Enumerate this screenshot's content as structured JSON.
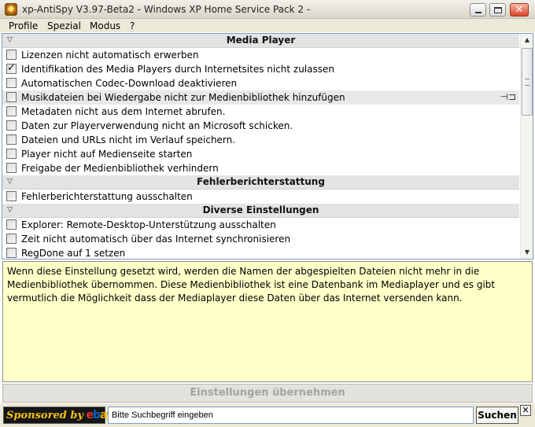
{
  "window": {
    "title": "xp-AntiSpy V3.97-Beta2 - Windows XP Home Service Pack 2 -",
    "minimize_glyph": "",
    "maximize_glyph": "",
    "close_glyph": "✕"
  },
  "menu": {
    "items": [
      "Profile",
      "Spezial",
      "Modus",
      "?"
    ]
  },
  "list": {
    "groups": [
      {
        "title": "Media Player",
        "items": [
          {
            "label": "Lizenzen nicht automatisch erwerben",
            "checked": false
          },
          {
            "label": "Identifikation des Media Players durch Internetsites nicht zulassen",
            "checked": true
          },
          {
            "label": "Automatischen Codec-Download deaktivieren",
            "checked": false
          },
          {
            "label": "Musikdateien bei Wiedergabe nicht zur Medienbibliothek hinzufügen",
            "checked": false,
            "selected": true
          },
          {
            "label": "Metadaten nicht aus dem Internet abrufen.",
            "checked": false
          },
          {
            "label": "Daten zur Playerverwendung nicht an Microsoft schicken.",
            "checked": false
          },
          {
            "label": "Dateien und URLs nicht im Verlauf speichern.",
            "checked": false
          },
          {
            "label": "Player nicht auf Medienseite starten",
            "checked": false
          },
          {
            "label": "Freigabe der Medienbibliothek verhindern",
            "checked": false
          }
        ]
      },
      {
        "title": "Fehlerberichterstattung",
        "items": [
          {
            "label": "Fehlerberichterstattung ausschalten",
            "checked": false
          }
        ]
      },
      {
        "title": "Diverse Einstellungen",
        "items": [
          {
            "label": "Explorer: Remote-Desktop-Unterstützung ausschalten",
            "checked": false
          },
          {
            "label": "Zeit nicht automatisch über das Internet synchronisieren",
            "checked": false
          },
          {
            "label": "RegDone auf 1 setzen",
            "checked": false
          }
        ]
      }
    ],
    "collapse_icon": "▽",
    "check_glyph": "✓",
    "pin_glyph": "⊣⊐",
    "scroll_up_glyph": "▲",
    "scroll_down_glyph": "▼"
  },
  "description": {
    "text": "Wenn diese Einstellung gesetzt wird, werden die Namen der abgespielten Dateien nicht mehr in die Medienbibliothek übernommen. Diese Medienbibliothek ist eine Datenbank im Mediaplayer und es gibt vermutlich die Möglichkeit dass der Mediaplayer diese Daten über das Internet versenden kann."
  },
  "apply_button": {
    "label": "Einstellungen übernehmen",
    "enabled": false
  },
  "sponsor": {
    "text": "Sponsored by",
    "brand_letters": [
      "e",
      "b",
      "a",
      "y"
    ],
    "brand_colors": [
      "#e53238",
      "#0064d2",
      "#f5af02",
      "#86b817"
    ],
    "search_placeholder": "Bitte Suchbegriff eingeben",
    "search_button": "Suchen",
    "close_glyph": "✕"
  },
  "colors": {
    "description_bg": "#ffffc8",
    "selected_row": "#e8e8e8",
    "group_header": "#e3e3e3"
  }
}
